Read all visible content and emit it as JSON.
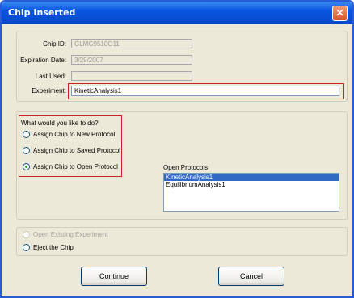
{
  "window": {
    "title": "Chip Inserted"
  },
  "chip_info": {
    "chip_id_label": "Chip ID:",
    "chip_id_value": "GLMG9510O11",
    "expiration_label": "Expiration Date:",
    "expiration_value": "3/29/2007",
    "last_used_label": "Last Used:",
    "last_used_value": "",
    "experiment_label": "Experiment:",
    "experiment_value": "KineticAnalysis1"
  },
  "options": {
    "prompt": "What would you like to do?",
    "radios": [
      {
        "label": "Assign Chip to New Protocol",
        "checked": false
      },
      {
        "label": "Assign Chip to Saved Protocol",
        "checked": false
      },
      {
        "label": "Assign Chip to Open Protocol",
        "checked": true
      }
    ],
    "open_protocols_label": "Open Protocols",
    "open_protocols": [
      "KineticAnalysis1",
      "EquilibriumAnalysis1"
    ],
    "selected_protocol": "KineticAnalysis1"
  },
  "bottom": {
    "open_existing_label": "Open Existing Experiment",
    "eject_label": "Eject the Chip"
  },
  "buttons": {
    "continue_label": "Continue",
    "cancel_label": "Cancel"
  }
}
